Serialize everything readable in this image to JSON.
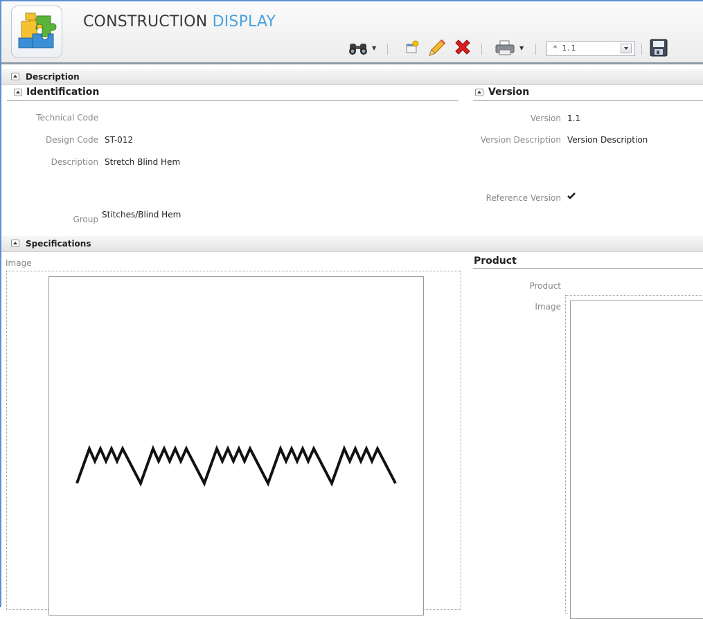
{
  "header": {
    "title_main": "CONSTRUCTION",
    "title_accent": "DISPLAY",
    "version_value": "* 1.1"
  },
  "icons": {
    "logo": "puzzle-logo-icon",
    "search": "binoculars-icon",
    "new": "new-document-icon",
    "edit": "pencil-icon",
    "delete": "red-x-icon",
    "print": "printer-icon",
    "save": "save-disk-icon",
    "check": "checkmark-icon"
  },
  "sections": {
    "description": "Description",
    "identification": "Identification",
    "version": "Version",
    "specifications": "Specifications",
    "product": "Product"
  },
  "identification": {
    "technical_code_label": "Technical Code",
    "technical_code_value": "",
    "design_code_label": "Design Code",
    "design_code_value": "ST-012",
    "description_label": "Description",
    "description_value": "Stretch Blind Hem",
    "group_label": "Group",
    "group_value": "Stitches/Blind Hem"
  },
  "version": {
    "version_label": "Version",
    "version_value": "1.1",
    "version_description_label": "Version Description",
    "version_description_value": "Version Description",
    "reference_version_label": "Reference Version"
  },
  "specifications": {
    "image_label": "Image"
  },
  "product": {
    "product_label": "Product",
    "product_value": "",
    "image_label": "Image"
  },
  "colors": {
    "accent": "#4aa3df",
    "frame": "#5b8fd0",
    "delete": "#d81e1e"
  }
}
